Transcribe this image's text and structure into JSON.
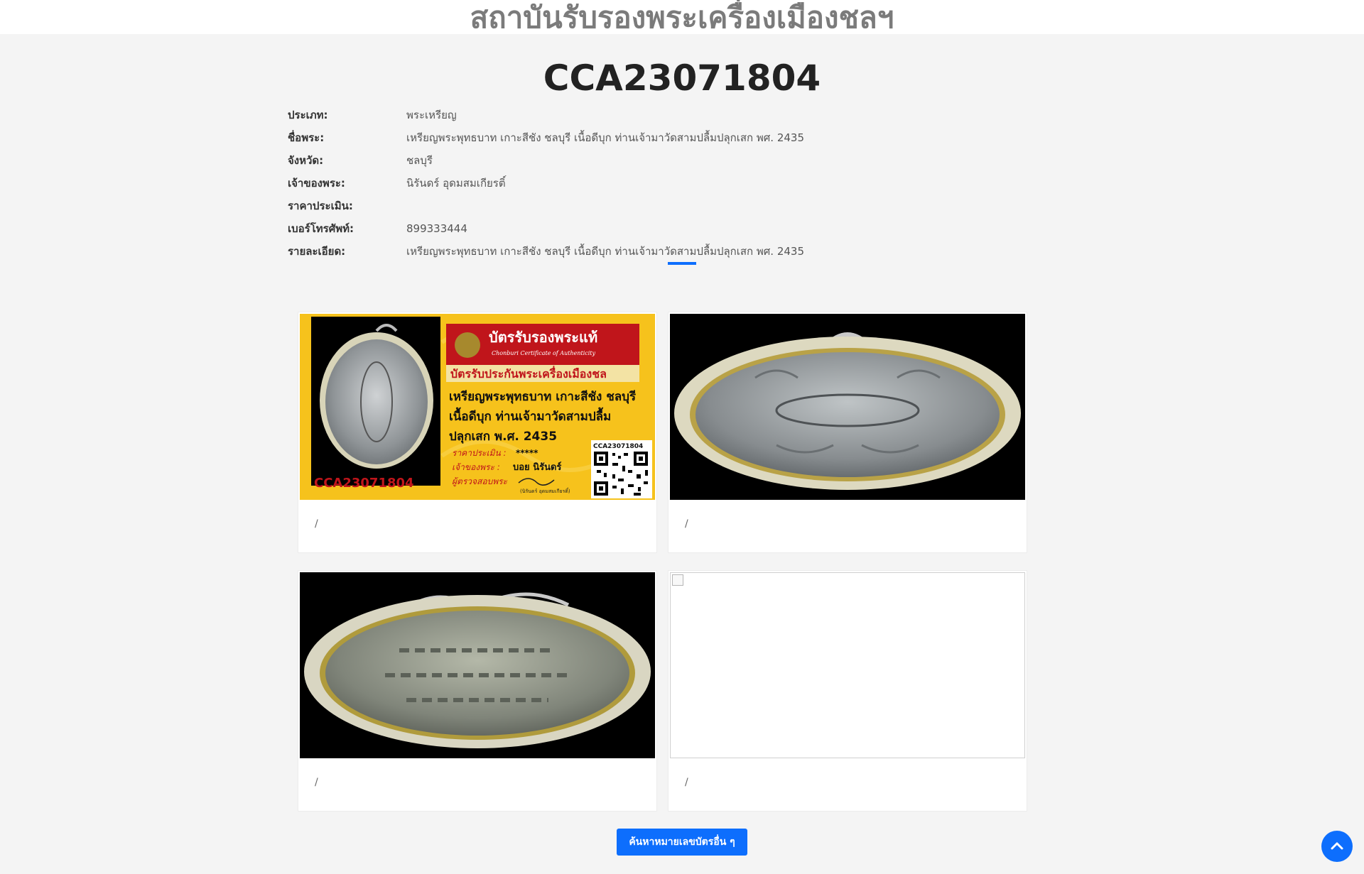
{
  "header": {
    "site_title": "สถาบันรับรองพระเครื่องเมืองชลฯ"
  },
  "certificate": {
    "code": "CCA23071804",
    "fields": [
      {
        "label": "ประเภท:",
        "value": "พระเหรียญ"
      },
      {
        "label": "ชื่อพระ:",
        "value": "เหรียญพระพุทธบาท เกาะสีชัง ชลบุรี เนื้อดีบุก ท่านเจ้ามาวัดสามปลื้มปลุกเสก พศ. 2435"
      },
      {
        "label": "จังหวัด:",
        "value": "ชลบุรี"
      },
      {
        "label": "เจ้าของพระ:",
        "value": "นิรันดร์ อุดมสมเกียรติ์"
      },
      {
        "label": "ราคาประเมิน:",
        "value": ""
      },
      {
        "label": "เบอร์โทรศัพท์:",
        "value": "899333444"
      },
      {
        "label": "รายละเอียด:",
        "value": "เหรียญพระพุทธบาท เกาะสีชัง ชลบุรี เนื้อดีบุก ท่านเจ้ามาวัดสามปลื้มปลุกเสก พศ. 2435"
      }
    ]
  },
  "card_image": {
    "banner_title": "บัตรรับรองพระแท้",
    "banner_subtitle": "Chonburi Certificate of Authenticity",
    "banner_band": "บัตรรับประกันพระเครื่องเมืองชล",
    "line1": "เหรียญพระพุทธบาท เกาะสีชัง ชลบุรี",
    "line2": "เนื้อดีบุก ท่านเจ้ามาวัดสามปลื้ม",
    "line3": "ปลุกเสก พ.ศ. 2435",
    "price_label": "ราคาประเมิน :",
    "price_value": "*****",
    "owner_label": "เจ้าของพระ :",
    "owner_value": "บอย นิรันดร์",
    "inspector_label": "ผู้ตรวจสอบพระ",
    "signature_name": "(นิรันดร์ อุดมสมเกียรติ์)",
    "qr_code_label": "CCA23071804",
    "card_code": "CCA23071804"
  },
  "gallery": [
    {
      "caption": "/"
    },
    {
      "caption": "/"
    },
    {
      "caption": "/"
    },
    {
      "caption": "/"
    }
  ],
  "actions": {
    "search_label": "ค้นหาหมายเลขบัตรอื่น ๆ",
    "scroll_top_icon": "chevron-up-icon"
  },
  "colors": {
    "accent": "#0d6efd",
    "card_yellow": "#f6c21c",
    "card_red": "#c0151b"
  }
}
